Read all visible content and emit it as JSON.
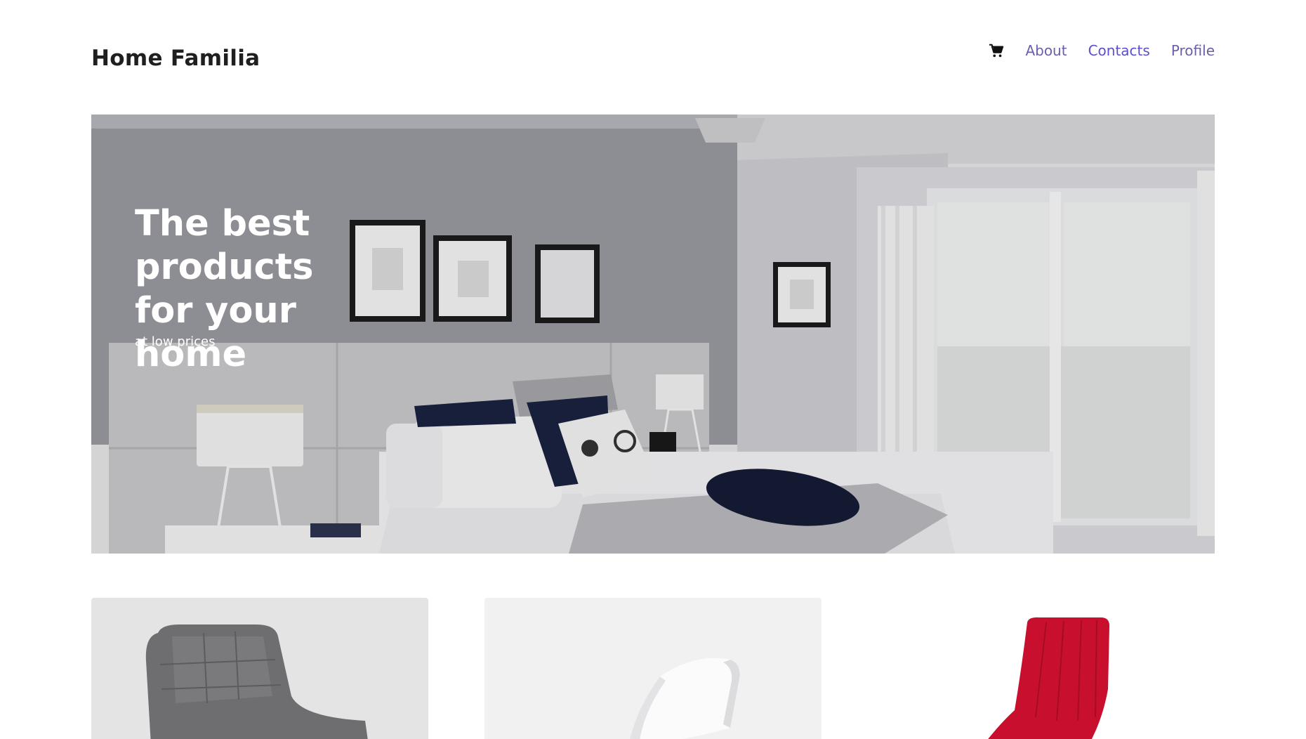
{
  "header": {
    "brand": "Home Familia",
    "nav": {
      "cart_icon": "cart-icon",
      "about": "About",
      "contacts": "Contacts",
      "profile": "Profile"
    }
  },
  "hero": {
    "title": "The best products for your home",
    "subtitle": "at low prices"
  },
  "products": [
    {
      "image": "grey-armchair"
    },
    {
      "image": "white-chair"
    },
    {
      "image": "red-chair"
    }
  ],
  "colors": {
    "nav_link": "#6b5fa8",
    "nav_link_active": "#5a4fcf",
    "text_dark": "#1f1f1f"
  }
}
